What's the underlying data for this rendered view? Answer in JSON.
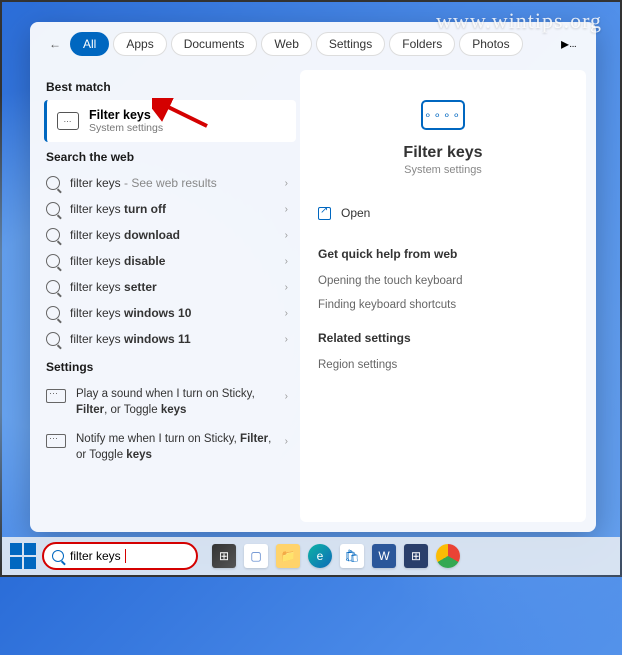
{
  "watermark": "www.wintips.org",
  "tabs": {
    "items": [
      "All",
      "Apps",
      "Documents",
      "Web",
      "Settings",
      "Folders",
      "Photos"
    ],
    "active_index": 0,
    "more": "▸··"
  },
  "left": {
    "best_match_h": "Best match",
    "match": {
      "title": "Filter keys",
      "subtitle": "System settings"
    },
    "web_h": "Search the web",
    "web_items": [
      {
        "prefix": "filter keys",
        "bold": "",
        "suffix": " - See web results",
        "suffix_light": true
      },
      {
        "prefix": "filter keys ",
        "bold": "turn off",
        "suffix": ""
      },
      {
        "prefix": "filter keys ",
        "bold": "download",
        "suffix": ""
      },
      {
        "prefix": "filter keys ",
        "bold": "disable",
        "suffix": ""
      },
      {
        "prefix": "filter keys ",
        "bold": "setter",
        "suffix": ""
      },
      {
        "prefix": "filter keys ",
        "bold": "windows 10",
        "suffix": ""
      },
      {
        "prefix": "filter keys ",
        "bold": "windows 11",
        "suffix": ""
      }
    ],
    "settings_h": "Settings",
    "settings_items": [
      {
        "pre": "Play a sound when I turn on Sticky, ",
        "bold": "Filter",
        "post": ", or Toggle ",
        "bold2": "keys"
      },
      {
        "pre": "Notify me when I turn on Sticky, ",
        "bold": "Filter",
        "post": ", or Toggle ",
        "bold2": "keys"
      }
    ]
  },
  "right": {
    "title": "Filter keys",
    "subtitle": "System settings",
    "open": "Open",
    "quick_h": "Get quick help from web",
    "quick_links": [
      "Opening the touch keyboard",
      "Finding keyboard shortcuts"
    ],
    "related_h": "Related settings",
    "related_links": [
      "Region settings"
    ]
  },
  "taskbar": {
    "search_value": "filter keys"
  }
}
